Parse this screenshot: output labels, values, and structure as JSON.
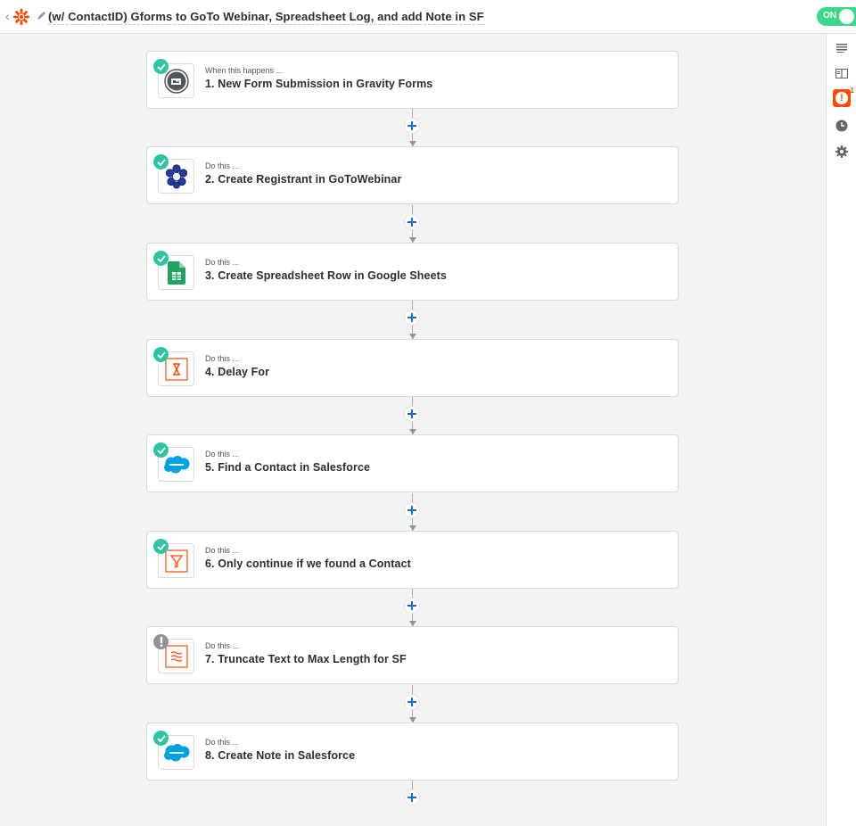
{
  "header": {
    "title": "(w/ ContactID) Gforms to GoTo Webinar, Spreadsheet Log, and add Note in SF",
    "toggle_label": "ON"
  },
  "colors": {
    "accent": "#ff4a00",
    "ok": "#2ec4a0",
    "toggle_on": "#3bd88a",
    "add_blue": "#136bf5",
    "warn": "#8e9497"
  },
  "steps": [
    {
      "kicker": "When this happens ...",
      "title": "1. New Form Submission in Gravity Forms",
      "status": "ok",
      "icon": "gravity-forms-icon"
    },
    {
      "kicker": "Do this ...",
      "title": "2. Create Registrant in GoToWebinar",
      "status": "ok",
      "icon": "gotowebinar-icon"
    },
    {
      "kicker": "Do this ...",
      "title": "3. Create Spreadsheet Row in Google Sheets",
      "status": "ok",
      "icon": "google-sheets-icon"
    },
    {
      "kicker": "Do this ...",
      "title": "4. Delay For",
      "status": "ok",
      "icon": "delay-hourglass-icon"
    },
    {
      "kicker": "Do this ...",
      "title": "5. Find a Contact in Salesforce",
      "status": "ok",
      "icon": "salesforce-icon"
    },
    {
      "kicker": "Do this ...",
      "title": "6. Only continue if we found a Contact",
      "status": "ok",
      "icon": "filter-icon"
    },
    {
      "kicker": "Do this ...",
      "title": "7. Truncate Text to Max Length for SF",
      "status": "warn",
      "icon": "formatter-icon"
    },
    {
      "kicker": "Do this ...",
      "title": "8. Create Note in Salesforce",
      "status": "ok",
      "icon": "salesforce-icon"
    }
  ],
  "rail": {
    "items": [
      "outline-icon",
      "guide-icon",
      "alert-icon",
      "history-icon",
      "settings-icon"
    ],
    "alert_count": "1"
  }
}
